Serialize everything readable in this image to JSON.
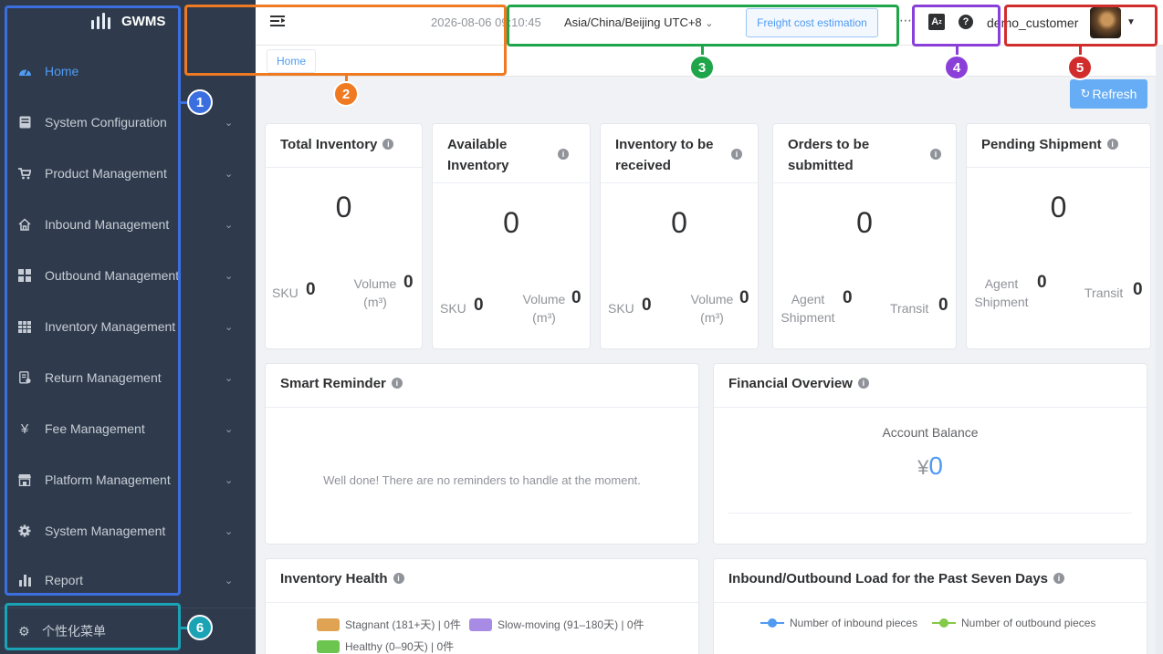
{
  "app": {
    "name": "GWMS"
  },
  "sidebar": {
    "items": [
      {
        "label": "Home",
        "icon": "dashboard-icon"
      },
      {
        "label": "System Configuration",
        "icon": "server-icon"
      },
      {
        "label": "Product Management",
        "icon": "cart-icon"
      },
      {
        "label": "Inbound Management",
        "icon": "home-icon"
      },
      {
        "label": "Outbound Management",
        "icon": "grid-icon"
      },
      {
        "label": "Inventory Management",
        "icon": "table-icon"
      },
      {
        "label": "Return Management",
        "icon": "return-icon"
      },
      {
        "label": "Fee Management",
        "icon": "yen-icon"
      },
      {
        "label": "Platform Management",
        "icon": "store-icon"
      },
      {
        "label": "System Management",
        "icon": "gear-icon"
      },
      {
        "label": "Report",
        "icon": "bar-chart-icon"
      }
    ],
    "personal_menu": "个性化菜单"
  },
  "header": {
    "datetime": "2026-08-06 09:10:45",
    "timezone": "Asia/China/Beijing UTC+8",
    "freight_button": "Freight cost estimation",
    "translate_label": "A",
    "help_label": "?",
    "username": "demo_customer"
  },
  "tabs": {
    "home": "Home"
  },
  "toolbar": {
    "refresh": "Refresh"
  },
  "stats": {
    "total_inventory": {
      "title": "Total Inventory",
      "value": "0",
      "sku_label": "SKU",
      "sku_value": "0",
      "volume_label": "Volume",
      "volume_unit": "(m³)",
      "volume_value": "0"
    },
    "available_inventory": {
      "title_line1": "Available",
      "title_line2": "Inventory",
      "value": "0",
      "sku_label": "SKU",
      "sku_value": "0",
      "volume_label": "Volume",
      "volume_unit": "(m³)",
      "volume_value": "0"
    },
    "to_be_received": {
      "title_line1": "Inventory to be",
      "title_line2": "received",
      "value": "0",
      "sku_label": "SKU",
      "sku_value": "0",
      "volume_label": "Volume",
      "volume_unit": "(m³)",
      "volume_value": "0"
    },
    "orders_to_submit": {
      "title_line1": "Orders to be",
      "title_line2": "submitted",
      "value": "0",
      "agent_label_1": "Agent",
      "agent_label_2": "Shipment",
      "agent_value": "0",
      "transit_label": "Transit",
      "transit_value": "0"
    },
    "pending_shipment": {
      "title": "Pending Shipment",
      "value": "0",
      "agent_label_1": "Agent",
      "agent_label_2": "Shipment",
      "agent_value": "0",
      "transit_label": "Transit",
      "transit_value": "0"
    }
  },
  "smart_reminder": {
    "title": "Smart Reminder",
    "empty_text": "Well done! There are no reminders to handle at the moment."
  },
  "financial": {
    "title": "Financial Overview",
    "balance_label": "Account Balance",
    "currency": "¥",
    "balance_value": "0"
  },
  "inventory_health": {
    "title": "Inventory Health",
    "legend": [
      {
        "label": "Stagnant (181+天) | 0件",
        "color": "#e0a353"
      },
      {
        "label": "Slow-moving (91–180天) | 0件",
        "color": "#a78be4"
      },
      {
        "label": "Healthy (0–90天) | 0件",
        "color": "#6cc54e"
      }
    ]
  },
  "load_chart": {
    "title": "Inbound/Outbound Load for the Past Seven Days",
    "legend": [
      {
        "label": "Number of inbound pieces",
        "color": "#4f9bf2"
      },
      {
        "label": "Number of outbound pieces",
        "color": "#84c94a"
      }
    ]
  },
  "annotations": [
    {
      "number": "1",
      "color": "#3b6fe0"
    },
    {
      "number": "2",
      "color": "#f07a22"
    },
    {
      "number": "3",
      "color": "#1fa54a"
    },
    {
      "number": "4",
      "color": "#8b3fd9"
    },
    {
      "number": "5",
      "color": "#d22d2d"
    },
    {
      "number": "6",
      "color": "#1aa3b5"
    }
  ]
}
